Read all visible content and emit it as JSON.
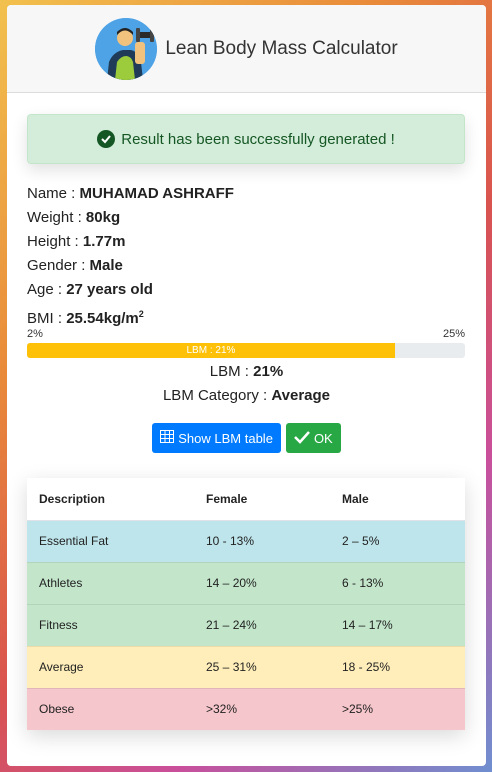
{
  "header": {
    "title": "Lean Body Mass Calculator",
    "logo_icon": "bodybuilder-dumbbell-icon"
  },
  "alert": {
    "message": "Result has been successfully generated !",
    "icon": "check-circle-icon"
  },
  "info": {
    "name_label": "Name :",
    "name_value": "MUHAMAD ASHRAFF",
    "weight_label": "Weight :",
    "weight_value": "80kg",
    "height_label": "Height :",
    "height_value": "1.77m",
    "gender_label": "Gender :",
    "gender_value": "Male",
    "age_label": "Age :",
    "age_value": "27 years old",
    "bmi_label": "BMI :",
    "bmi_value": "25.54kg/m",
    "bmi_unit_sup": "2"
  },
  "progress": {
    "min_label": "2%",
    "max_label": "25%",
    "bar_label": "LBM : 21%",
    "fraction": 0.84,
    "color": "#ffc107"
  },
  "result": {
    "lbm_label": "LBM :",
    "lbm_value": "21%",
    "category_label": "LBM Category :",
    "category_value": "Average"
  },
  "buttons": {
    "table_label": "Show LBM table",
    "table_icon": "table-icon",
    "ok_label": "OK",
    "ok_icon": "checkmark-icon"
  },
  "table": {
    "headers": [
      "Description",
      "Female",
      "Male"
    ],
    "rows": [
      {
        "desc": "Essential Fat",
        "female": "10 - 13%",
        "male": "2 – 5%",
        "color": "#bee5eb"
      },
      {
        "desc": "Athletes",
        "female": "14 – 20%",
        "male": "6 - 13%",
        "color": "#c3e6cb"
      },
      {
        "desc": "Fitness",
        "female": "21 – 24%",
        "male": "14 – 17%",
        "color": "#c3e6cb"
      },
      {
        "desc": "Average",
        "female": "25 – 31%",
        "male": "18 - 25%",
        "color": "#ffeeba"
      },
      {
        "desc": "Obese",
        "female": ">32%",
        "male": ">25%",
        "color": "#f5c6cb"
      }
    ]
  }
}
